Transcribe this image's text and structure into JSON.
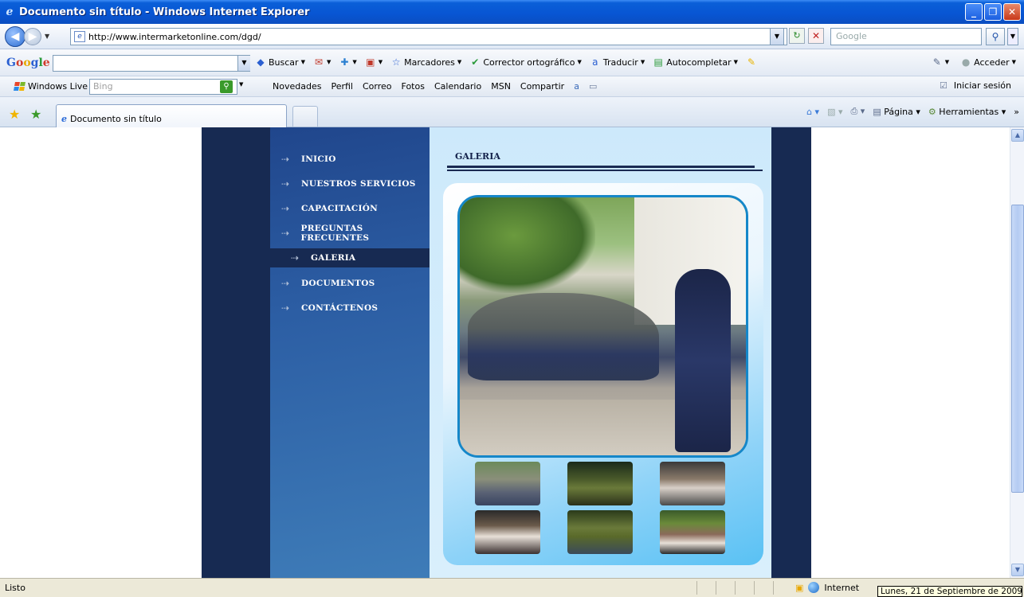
{
  "window": {
    "title": "Documento sin título - Windows Internet Explorer"
  },
  "address_bar": {
    "url": "http://www.intermarketonline.com/dgd/",
    "search_placeholder": "Google"
  },
  "google_toolbar": {
    "logo": "Google",
    "items": [
      "Buscar",
      "Marcadores",
      "Corrector ortográfico",
      "Traducir",
      "Autocompletar"
    ],
    "acceder": "Acceder"
  },
  "live_toolbar": {
    "brand": "Windows Live",
    "search_placeholder": "Bing",
    "links": [
      "Novedades",
      "Perfil",
      "Correo",
      "Fotos",
      "Calendario",
      "MSN",
      "Compartir"
    ],
    "signin": "Iniciar sesión"
  },
  "tab": {
    "title": "Documento sin título"
  },
  "command_bar": {
    "page": "Página",
    "tools": "Herramientas"
  },
  "site": {
    "menu": [
      {
        "label": "INICIO",
        "active": false
      },
      {
        "label": "NUESTROS SERVICIOS",
        "active": false
      },
      {
        "label": "CAPACITACIÓN",
        "active": false
      },
      {
        "label": "PREGUNTAS FRECUENTES",
        "active": false
      },
      {
        "label": "GALERIA",
        "active": true
      },
      {
        "label": "DOCUMENTOS",
        "active": false
      },
      {
        "label": "CONTÁCTENOS",
        "active": false
      }
    ],
    "section_title": "GALERIA"
  },
  "status_bar": {
    "status": "Listo",
    "zone": "Internet",
    "date_tooltip": "Lunes, 21 de Septiembre de 2009"
  }
}
